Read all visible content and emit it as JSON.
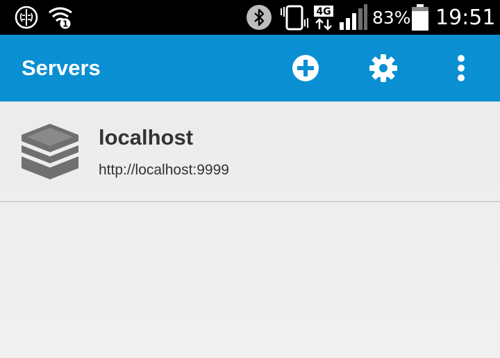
{
  "status_bar": {
    "network_type": "4G",
    "battery_percent": "83%",
    "battery_level": 0.83,
    "time": "19:51",
    "wifi_badge": "1",
    "icons": [
      "brain-icon",
      "wifi-icon",
      "bluetooth-icon",
      "vibrate-icon",
      "data-arrows-icon",
      "signal-icon",
      "battery-icon"
    ]
  },
  "app_bar": {
    "title": "Servers",
    "actions": [
      "add-icon",
      "settings-icon",
      "overflow-menu-icon"
    ],
    "color": "#0b8fd3"
  },
  "servers": [
    {
      "name": "localhost",
      "url": "http://localhost:9999",
      "icon": "server-stack-icon"
    }
  ]
}
